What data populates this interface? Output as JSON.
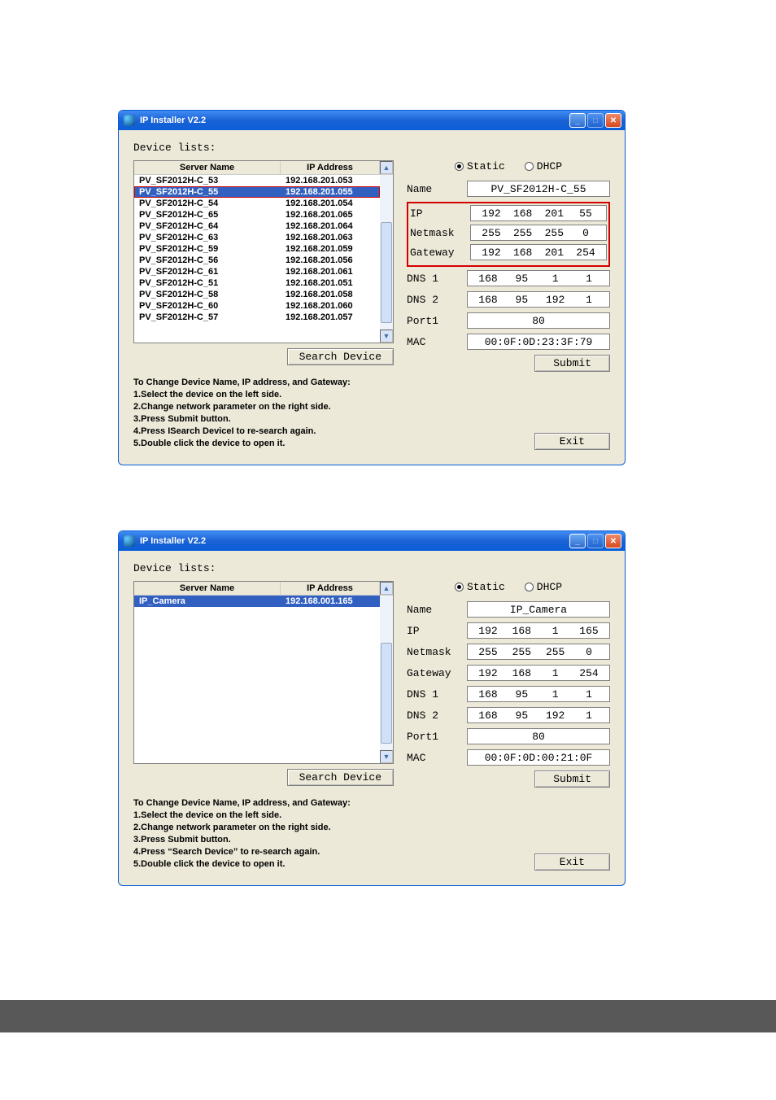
{
  "dialogs": [
    {
      "title": "IP Installer V2.2",
      "device_lists_label": "Device lists:",
      "table": {
        "col1": "Server Name",
        "col2": "IP Address",
        "rows": [
          {
            "name": "PV_SF2012H-C_53",
            "ip": "192.168.201.053",
            "selected": false,
            "redbox": false
          },
          {
            "name": "PV_SF2012H-C_55",
            "ip": "192.168.201.055",
            "selected": true,
            "redbox": true
          },
          {
            "name": "PV_SF2012H-C_54",
            "ip": "192.168.201.054",
            "selected": false,
            "redbox": false
          },
          {
            "name": "PV_SF2012H-C_65",
            "ip": "192.168.201.065",
            "selected": false,
            "redbox": false
          },
          {
            "name": "PV_SF2012H-C_64",
            "ip": "192.168.201.064",
            "selected": false,
            "redbox": false
          },
          {
            "name": "PV_SF2012H-C_63",
            "ip": "192.168.201.063",
            "selected": false,
            "redbox": false
          },
          {
            "name": "PV_SF2012H-C_59",
            "ip": "192.168.201.059",
            "selected": false,
            "redbox": false
          },
          {
            "name": "PV_SF2012H-C_56",
            "ip": "192.168.201.056",
            "selected": false,
            "redbox": false
          },
          {
            "name": "PV_SF2012H-C_61",
            "ip": "192.168.201.061",
            "selected": false,
            "redbox": false
          },
          {
            "name": "PV_SF2012H-C_51",
            "ip": "192.168.201.051",
            "selected": false,
            "redbox": false
          },
          {
            "name": "PV_SF2012H-C_58",
            "ip": "192.168.201.058",
            "selected": false,
            "redbox": false
          },
          {
            "name": "PV_SF2012H-C_60",
            "ip": "192.168.201.060",
            "selected": false,
            "redbox": false
          },
          {
            "name": "PV_SF2012H-C_57",
            "ip": "192.168.201.057",
            "selected": false,
            "redbox": false
          }
        ]
      },
      "search_btn": "Search Device",
      "instructions": [
        "To Change Device Name, IP address, and Gateway:",
        "1.Select the device on the left side.",
        "2.Change network parameter on the right side.",
        "3.Press Submit button.",
        "4.Press ISearch DeviceI to re-search again.",
        "5.Double click the device to open it."
      ],
      "radio": {
        "static": "Static",
        "dhcp": "DHCP",
        "selected": "static"
      },
      "form": {
        "name_lbl": "Name",
        "name_val": "PV_SF2012H-C_55",
        "ip_lbl": "IP",
        "ip": [
          "192",
          "168",
          "201",
          "55"
        ],
        "nm_lbl": "Netmask",
        "netmask": [
          "255",
          "255",
          "255",
          "0"
        ],
        "gw_lbl": "Gateway",
        "gateway": [
          "192",
          "168",
          "201",
          "254"
        ],
        "d1_lbl": "DNS 1",
        "dns1": [
          "168",
          "95",
          "1",
          "1"
        ],
        "d2_lbl": "DNS 2",
        "dns2": [
          "168",
          "95",
          "192",
          "1"
        ],
        "p1_lbl": "Port1",
        "port1": "80",
        "mac_lbl": "MAC",
        "mac": "00:0F:0D:23:3F:79",
        "red_group": true
      },
      "submit_btn": "Submit",
      "exit_btn": "Exit"
    },
    {
      "title": "IP Installer V2.2",
      "device_lists_label": "Device lists:",
      "table": {
        "col1": "Server Name",
        "col2": "IP Address",
        "rows": [
          {
            "name": "IP_Camera",
            "ip": "192.168.001.165",
            "selected": true,
            "redbox": false
          }
        ]
      },
      "search_btn": "Search Device",
      "instructions": [
        "To Change Device Name, IP address, and Gateway:",
        "1.Select the device on the left side.",
        "2.Change network parameter on the right side.",
        "3.Press Submit button.",
        "4.Press “Search Device” to re-search again.",
        "5.Double click the device to open it."
      ],
      "radio": {
        "static": "Static",
        "dhcp": "DHCP",
        "selected": "static"
      },
      "form": {
        "name_lbl": "Name",
        "name_val": "IP_Camera",
        "ip_lbl": "IP",
        "ip": [
          "192",
          "168",
          "1",
          "165"
        ],
        "nm_lbl": "Netmask",
        "netmask": [
          "255",
          "255",
          "255",
          "0"
        ],
        "gw_lbl": "Gateway",
        "gateway": [
          "192",
          "168",
          "1",
          "254"
        ],
        "d1_lbl": "DNS 1",
        "dns1": [
          "168",
          "95",
          "1",
          "1"
        ],
        "d2_lbl": "DNS 2",
        "dns2": [
          "168",
          "95",
          "192",
          "1"
        ],
        "p1_lbl": "Port1",
        "port1": "80",
        "mac_lbl": "MAC",
        "mac": "00:0F:0D:00:21:0F",
        "red_group": false
      },
      "submit_btn": "Submit",
      "exit_btn": "Exit"
    }
  ]
}
